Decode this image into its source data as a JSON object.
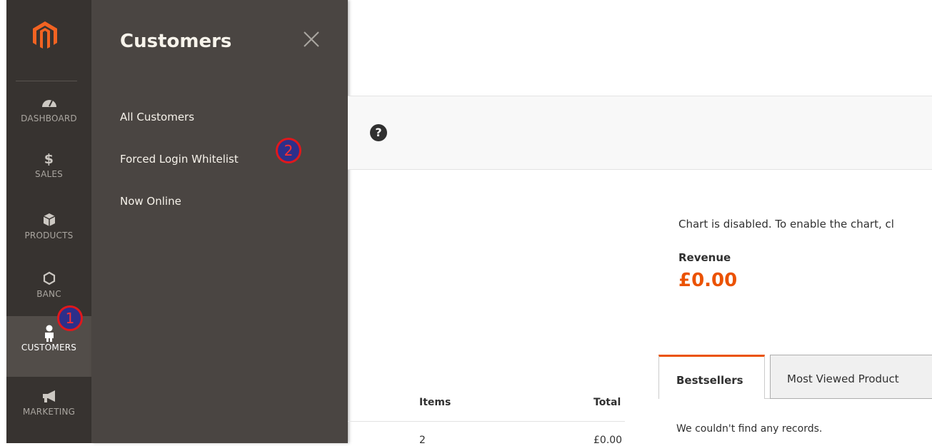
{
  "nav": {
    "items": [
      {
        "label": "DASHBOARD",
        "icon": "dashboard-icon"
      },
      {
        "label": "SALES",
        "icon": "dollar-icon"
      },
      {
        "label": "PRODUCTS",
        "icon": "cube-icon"
      },
      {
        "label": "BANC",
        "icon": "hexagon-icon"
      },
      {
        "label": "CUSTOMERS",
        "icon": "person-icon",
        "active": true
      },
      {
        "label": "MARKETING",
        "icon": "megaphone-icon"
      }
    ]
  },
  "submenu": {
    "title": "Customers",
    "links": [
      "All Customers",
      "Forced Login Whitelist",
      "Now Online"
    ]
  },
  "markers": [
    "1",
    "2"
  ],
  "dashboard": {
    "chart_message": "Chart is disabled. To enable the chart, cl",
    "revenue_label": "Revenue",
    "revenue_value": "£0.00",
    "tabs": [
      "Bestsellers",
      "Most Viewed Product"
    ],
    "no_records": "We couldn't find any records.",
    "table": {
      "columns": [
        "Items",
        "Total"
      ],
      "row": {
        "items": "2",
        "total": "£0.00"
      }
    }
  },
  "colors": {
    "nav_bg": "#373330",
    "submenu_bg": "#4a4542",
    "accent": "#eb5202",
    "marker_border": "#e0181c",
    "marker_fill": "#2d2f8a"
  }
}
